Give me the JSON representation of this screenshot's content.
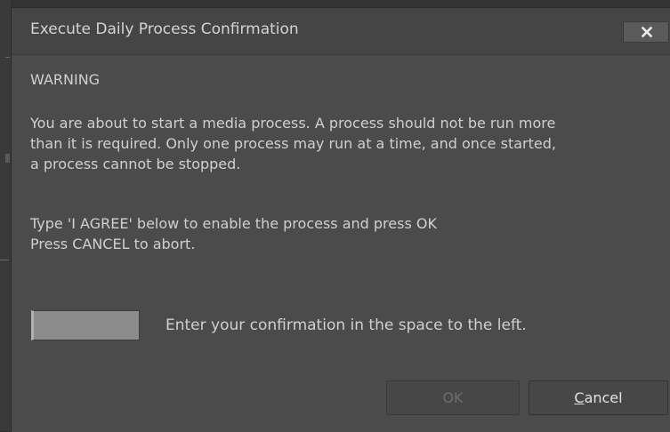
{
  "dialog": {
    "title": "Execute Daily Process Confirmation",
    "warning_heading": "WARNING",
    "message_lines": [
      "You are about to start a media process.  A process should not be run more",
      "than it is required.  Only one process may run at a time, and once started,",
      "a process cannot be stopped."
    ],
    "instruction_lines": [
      "Type 'I AGREE' below to enable the process and press OK",
      "Press CANCEL to abort."
    ],
    "confirmation_input": {
      "value": "",
      "placeholder": ""
    },
    "confirmation_hint": "Enter your confirmation in the space to the left.",
    "buttons": {
      "ok_label": "OK",
      "ok_enabled": false,
      "cancel_mnemonic": "C",
      "cancel_rest": "ancel"
    },
    "close_icon": "close-icon"
  },
  "colors": {
    "dialog_background": "#4b4b4b",
    "titlebar_background": "#454545",
    "text": "#d0d0d0",
    "disabled_text": "#6e6e6e",
    "input_background": "#8c8c8c"
  }
}
